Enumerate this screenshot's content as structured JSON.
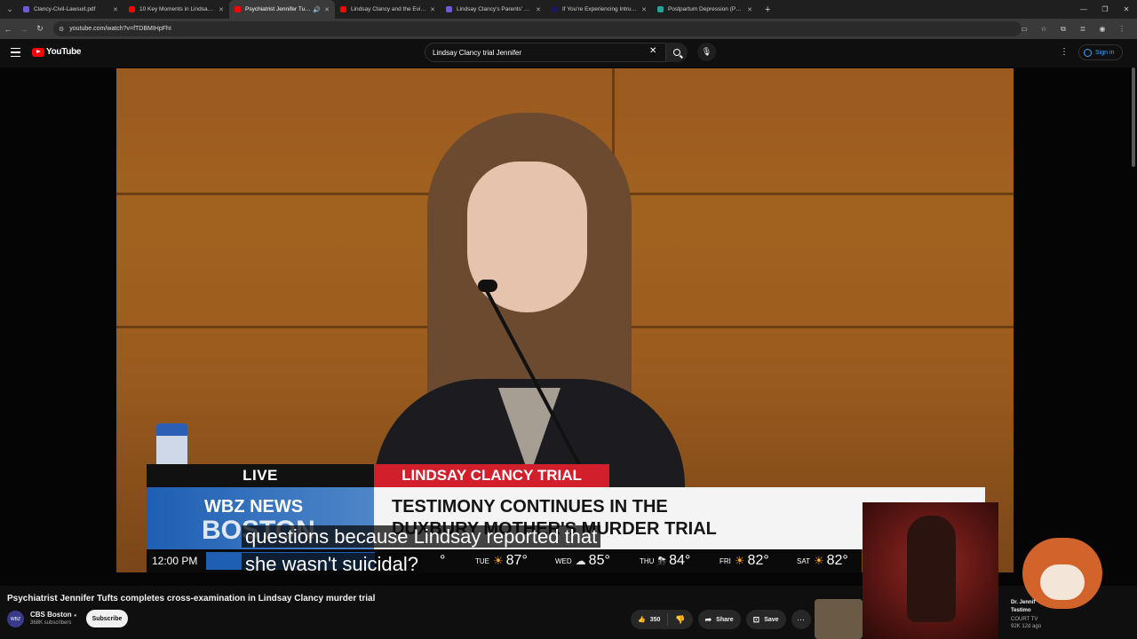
{
  "browser": {
    "tabs": [
      {
        "label": "Clancy-Civil-Lawsuit.pdf",
        "color": "#6b5bd6"
      },
      {
        "label": "10 Key Moments in Lindsay Cla",
        "color": "#ff0000"
      },
      {
        "label": "Psychiatrist Jennifer Tufts c",
        "color": "#ff0000",
        "active": true
      },
      {
        "label": "Lindsay Clancy and the Evidenc",
        "color": "#ff0000"
      },
      {
        "label": "Lindsay Clancy's Parents' $1 Mi",
        "color": "#6b5bd6"
      },
      {
        "label": "If You're Experiencing Intrusive",
        "color": "#1a1a5a"
      },
      {
        "label": "Postpartum Depression (PPD)",
        "color": "#2aa198"
      }
    ],
    "url": "youtube.com/watch?v=fTDBMIHpFhI"
  },
  "header": {
    "logo": "YouTube",
    "search_query": "Lindsay Clancy trial Jennifer",
    "signin": "Sign in"
  },
  "video": {
    "lower_third": {
      "live": "LIVE",
      "tag": "LINDSAY CLANCY TRIAL",
      "station_line1": "WBZ NEWS",
      "station_line2": "BOSTON",
      "headline_line1": "TESTIMONY CONTINUES IN THE",
      "headline_line2": "DUXBURY MOTHER'S MURDER TRIAL",
      "time": "12:00 PM",
      "weather": [
        {
          "day": "",
          "temp": "°",
          "icon": "none"
        },
        {
          "day": "TUE",
          "temp": "87°",
          "icon": "sun"
        },
        {
          "day": "WED",
          "temp": "85°",
          "icon": "cloud"
        },
        {
          "day": "THU",
          "temp": "84°",
          "icon": "storm"
        },
        {
          "day": "FRI",
          "temp": "82°",
          "icon": "sun"
        },
        {
          "day": "SAT",
          "temp": "82°",
          "icon": "sun"
        }
      ]
    },
    "captions": {
      "line1": "questions because Lindsay reported that",
      "line2": "she wasn't suicidal?"
    }
  },
  "details": {
    "title": "Psychiatrist Jennifer Tufts completes cross-examination in Lindsay Clancy murder trial",
    "channel": "CBS Boston",
    "subscribers": "368K subscribers",
    "subscribe": "Subscribe",
    "likes": "350",
    "share": "Share",
    "save": "Save",
    "avatar_text": "WBZ"
  },
  "recommendation": {
    "title_line1": "Dr. Jennif",
    "title_line2": "Testimo",
    "channel": "COURT TV",
    "meta": "92K   12d ago"
  }
}
